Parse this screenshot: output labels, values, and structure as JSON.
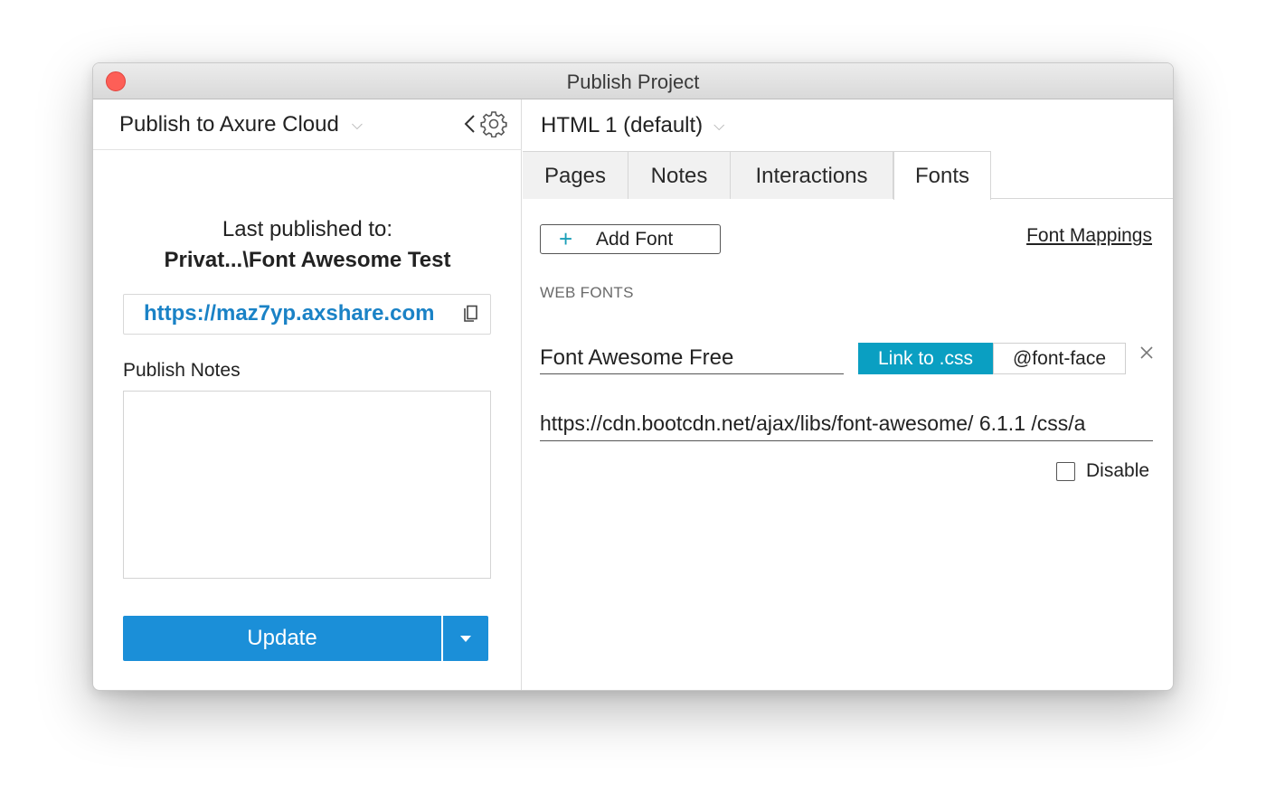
{
  "window": {
    "title": "Publish Project"
  },
  "left": {
    "target": "Publish to Axure Cloud",
    "last_published_label": "Last published to:",
    "last_published_path": "Privat...\\Font Awesome Test",
    "url": "https://maz7yp.axshare.com",
    "notes_label": "Publish Notes",
    "notes_value": "",
    "update_label": "Update"
  },
  "right": {
    "config": "HTML 1 (default)",
    "tabs": [
      {
        "label": "Pages"
      },
      {
        "label": "Notes"
      },
      {
        "label": "Interactions"
      },
      {
        "label": "Fonts"
      }
    ],
    "active_tab": "Fonts",
    "add_font_label": "Add Font",
    "font_mappings_label": "Font Mappings",
    "web_fonts_heading": "WEB FONTS",
    "font": {
      "name": "Font Awesome Free",
      "link_css_label": "Link to .css",
      "font_face_label": "@font-face",
      "selected_mode": "Link to .css",
      "url": "https://cdn.bootcdn.net/ajax/libs/font-awesome/ 6.1.1 /css/a",
      "disable_label": "Disable",
      "disabled": false
    }
  },
  "icons": [
    "close-dot",
    "chevron-down-icon",
    "collapse-icon",
    "gear-icon",
    "copy-icon",
    "plus-icon",
    "remove-icon",
    "dropdown-arrow-icon"
  ],
  "colors": {
    "primary_button": "#1b8fd8",
    "link": "#1a82c6",
    "segment_active": "#0a9fc2",
    "plus": "#1b9fb8",
    "close_dot": "#fd5f57"
  }
}
